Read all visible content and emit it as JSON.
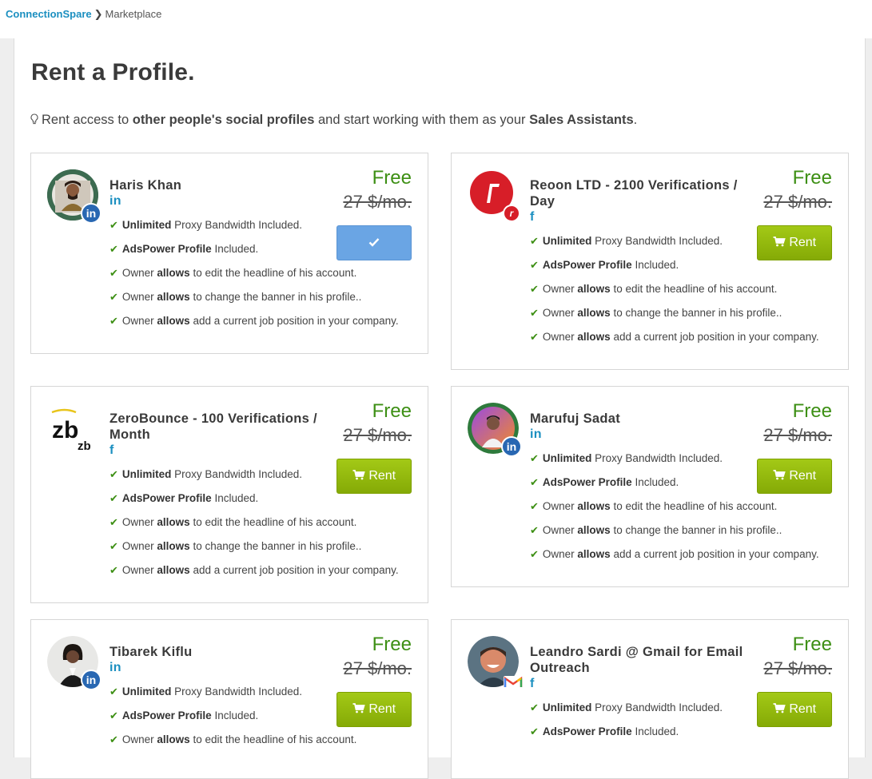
{
  "breadcrumb": {
    "brand": "ConnectionSpare",
    "separator": "❯",
    "current": "Marketplace"
  },
  "page": {
    "title": "Rent a Profile.",
    "intro_pre": "Rent access to ",
    "intro_bold1": "other people's social profiles",
    "intro_mid": " and start working with them as your ",
    "intro_bold2": "Sales Assistants",
    "intro_end": "."
  },
  "price": {
    "free": "Free",
    "old": "27 $/mo."
  },
  "buttons": {
    "rent_label": "Rent",
    "rent_icon": "shopping-cart-icon",
    "rented_icon": "check-icon"
  },
  "features": [
    {
      "bold": "Unlimited",
      "text": " Proxy Bandwidth Included."
    },
    {
      "bold": "AdsPower Profile",
      "text": " Included."
    },
    {
      "pre": "Owner ",
      "bold": "allows",
      "text": " to edit the headline of his account."
    },
    {
      "pre": "Owner ",
      "bold": "allows",
      "text": " to change the banner in his profile.."
    },
    {
      "pre": "Owner ",
      "bold": "allows",
      "text": " add a current job position in your company."
    }
  ],
  "profiles": [
    {
      "name": "Haris Khan",
      "network": "in",
      "network_icon": "linkedin-icon",
      "status": "rented"
    },
    {
      "name": "Reoon LTD - 2100 Verifications / Day",
      "network": "f",
      "network_icon": "facebook-icon",
      "status": "available"
    },
    {
      "name": "ZeroBounce - 100 Verifications / Month",
      "network": "f",
      "network_icon": "facebook-icon",
      "status": "available"
    },
    {
      "name": "Marufuj Sadat",
      "network": "in",
      "network_icon": "linkedin-icon",
      "status": "available"
    },
    {
      "name": "Tibarek Kiflu",
      "network": "in",
      "network_icon": "linkedin-icon",
      "status": "available"
    },
    {
      "name": "Leandro Sardi @ Gmail for Email Outreach",
      "network": "f",
      "network_icon": "facebook-icon",
      "status": "available"
    }
  ],
  "logos": {
    "zerobounce_main": "zb",
    "zerobounce_small": "zb",
    "reoon": "r"
  },
  "colors": {
    "brand_blue": "#1b8fc0",
    "free_green": "#3d8f14",
    "rent_green": "#8db40a",
    "rented_blue": "#6aa5e4"
  }
}
